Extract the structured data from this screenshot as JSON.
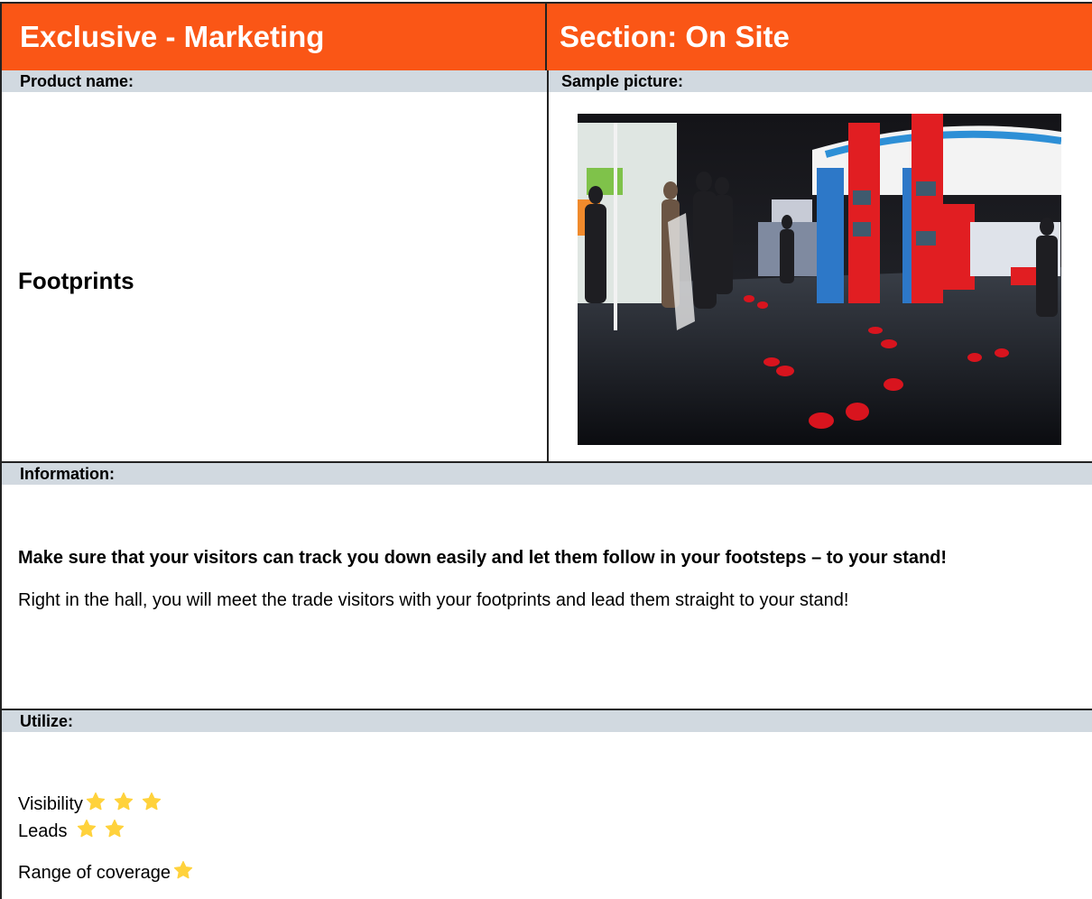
{
  "header": {
    "left_title": "Exclusive - Marketing",
    "right_title": "Section: On Site"
  },
  "product": {
    "label": "Product name:",
    "name": "Footprints"
  },
  "sample": {
    "label": "Sample picture:"
  },
  "information": {
    "label": "Information:",
    "headline": "Make sure that your visitors can track you down easily and let them follow in your footsteps – to your stand!",
    "body": "Right in the hall, you will meet the trade visitors with your footprints and lead them straight to your stand!"
  },
  "utilize": {
    "label": "Utilize:",
    "ratings": [
      {
        "label": "Visibility",
        "stars": 3
      },
      {
        "label": "Leads",
        "stars": 2
      },
      {
        "label": "Range of coverage",
        "stars": 1
      }
    ]
  },
  "colors": {
    "header_orange": "#fa5616",
    "band_grey": "#d1d9e0",
    "star_yellow": "#ffd23c",
    "footprint_red": "#d8141e"
  },
  "icons": {
    "star": "star-icon"
  }
}
